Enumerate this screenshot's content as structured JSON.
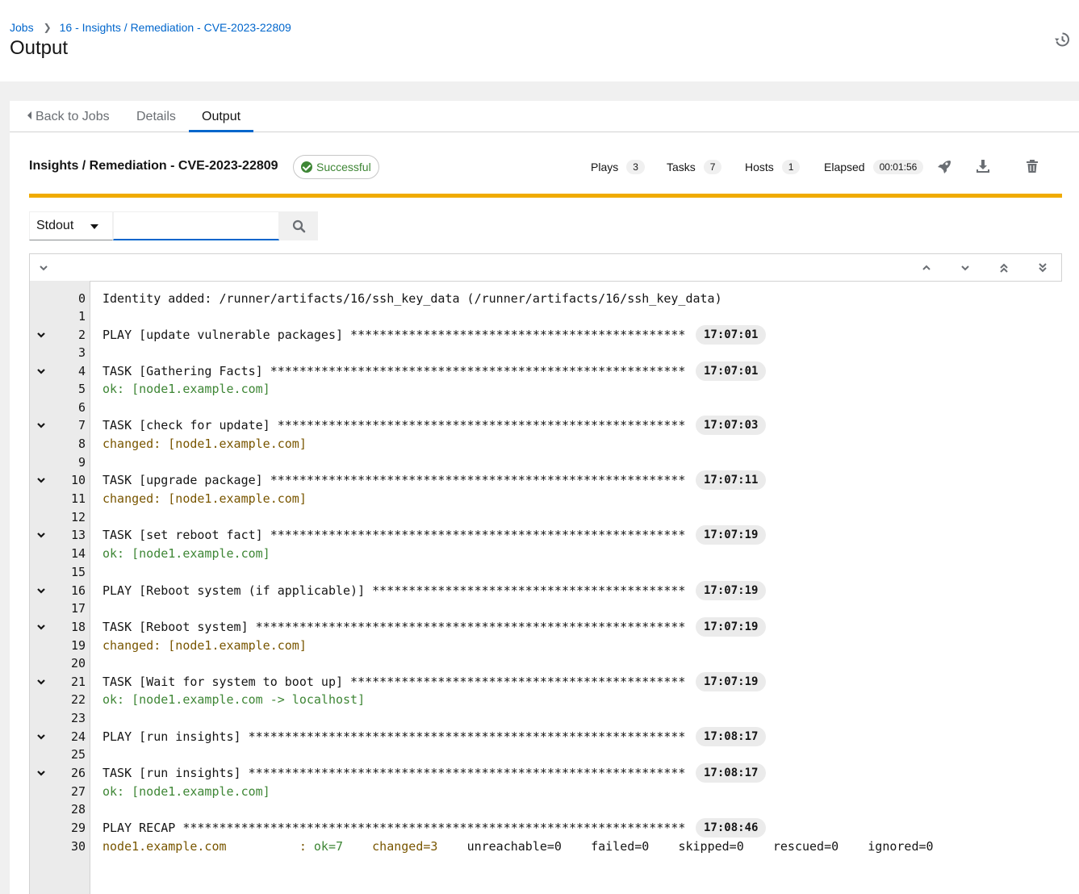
{
  "breadcrumb": {
    "root": "Jobs",
    "current": "16 - Insights / Remediation - CVE-2023-22809"
  },
  "page": {
    "title": "Output"
  },
  "tabs": {
    "back": "Back to Jobs",
    "details": "Details",
    "output": "Output"
  },
  "job": {
    "name": "Insights / Remediation - CVE-2023-22809",
    "status": "Successful"
  },
  "stats": {
    "plays_label": "Plays",
    "plays": "3",
    "tasks_label": "Tasks",
    "tasks": "7",
    "hosts_label": "Hosts",
    "hosts": "1",
    "elapsed_label": "Elapsed",
    "elapsed": "00:01:56"
  },
  "filter": {
    "select": "Stdout",
    "input_value": ""
  },
  "colors": {
    "accent": "#0066cc",
    "progress": "#f0ab00",
    "ok": "#3e8635",
    "changed": "#795600"
  },
  "icons": {
    "history": "history-icon",
    "relaunch": "rocket-icon",
    "download": "download-icon",
    "delete": "trash-icon",
    "search": "search-icon",
    "collapse_all": "chevron-down-icon",
    "scroll_up": "chevron-up-icon",
    "scroll_down": "chevron-down-icon",
    "scroll_top": "double-chevron-up-icon",
    "scroll_bottom": "double-chevron-down-icon"
  },
  "lines": [
    {
      "n": "0",
      "text": "Identity added: /runner/artifacts/16/ssh_key_data (/runner/artifacts/16/ssh_key_data)",
      "ts": "",
      "kind": "plain",
      "toggle": false
    },
    {
      "n": "1",
      "text": "",
      "ts": "",
      "kind": "plain",
      "toggle": false
    },
    {
      "n": "2",
      "text": "PLAY [update vulnerable packages] **********************************************",
      "ts": "17:07:01",
      "kind": "plain",
      "toggle": true
    },
    {
      "n": "3",
      "text": "",
      "ts": "",
      "kind": "plain",
      "toggle": false
    },
    {
      "n": "4",
      "text": "TASK [Gathering Facts] *********************************************************",
      "ts": "17:07:01",
      "kind": "plain",
      "toggle": true
    },
    {
      "n": "5",
      "text": "ok: [node1.example.com]",
      "ts": "",
      "kind": "ok",
      "toggle": false
    },
    {
      "n": "6",
      "text": "",
      "ts": "",
      "kind": "plain",
      "toggle": false
    },
    {
      "n": "7",
      "text": "TASK [check for update] ********************************************************",
      "ts": "17:07:03",
      "kind": "plain",
      "toggle": true
    },
    {
      "n": "8",
      "text": "changed: [node1.example.com]",
      "ts": "",
      "kind": "changed",
      "toggle": false
    },
    {
      "n": "9",
      "text": "",
      "ts": "",
      "kind": "plain",
      "toggle": false
    },
    {
      "n": "10",
      "text": "TASK [upgrade package] *********************************************************",
      "ts": "17:07:11",
      "kind": "plain",
      "toggle": true
    },
    {
      "n": "11",
      "text": "changed: [node1.example.com]",
      "ts": "",
      "kind": "changed",
      "toggle": false
    },
    {
      "n": "12",
      "text": "",
      "ts": "",
      "kind": "plain",
      "toggle": false
    },
    {
      "n": "13",
      "text": "TASK [set reboot fact] *********************************************************",
      "ts": "17:07:19",
      "kind": "plain",
      "toggle": true
    },
    {
      "n": "14",
      "text": "ok: [node1.example.com]",
      "ts": "",
      "kind": "ok",
      "toggle": false
    },
    {
      "n": "15",
      "text": "",
      "ts": "",
      "kind": "plain",
      "toggle": false
    },
    {
      "n": "16",
      "text": "PLAY [Reboot system (if applicable)] *******************************************",
      "ts": "17:07:19",
      "kind": "plain",
      "toggle": true
    },
    {
      "n": "17",
      "text": "",
      "ts": "",
      "kind": "plain",
      "toggle": false
    },
    {
      "n": "18",
      "text": "TASK [Reboot system] ***********************************************************",
      "ts": "17:07:19",
      "kind": "plain",
      "toggle": true
    },
    {
      "n": "19",
      "text": "changed: [node1.example.com]",
      "ts": "",
      "kind": "changed",
      "toggle": false
    },
    {
      "n": "20",
      "text": "",
      "ts": "",
      "kind": "plain",
      "toggle": false
    },
    {
      "n": "21",
      "text": "TASK [Wait for system to boot up] **********************************************",
      "ts": "17:07:19",
      "kind": "plain",
      "toggle": true
    },
    {
      "n": "22",
      "text": "ok: [node1.example.com -> localhost]",
      "ts": "",
      "kind": "ok",
      "toggle": false
    },
    {
      "n": "23",
      "text": "",
      "ts": "",
      "kind": "plain",
      "toggle": false
    },
    {
      "n": "24",
      "text": "PLAY [run insights] ************************************************************",
      "ts": "17:08:17",
      "kind": "plain",
      "toggle": true
    },
    {
      "n": "25",
      "text": "",
      "ts": "",
      "kind": "plain",
      "toggle": false
    },
    {
      "n": "26",
      "text": "TASK [run insights] ************************************************************",
      "ts": "17:08:17",
      "kind": "plain",
      "toggle": true
    },
    {
      "n": "27",
      "text": "ok: [node1.example.com]",
      "ts": "",
      "kind": "ok",
      "toggle": false
    },
    {
      "n": "28",
      "text": "",
      "ts": "",
      "kind": "plain",
      "toggle": false
    },
    {
      "n": "29",
      "text": "PLAY RECAP *********************************************************************",
      "ts": "17:08:46",
      "kind": "plain",
      "toggle": false
    },
    {
      "n": "30",
      "text": "",
      "ts": "",
      "kind": "recap",
      "toggle": false
    }
  ],
  "recap": {
    "host": "node1.example.com          : ",
    "ok": "ok=7",
    "changed": "changed=3",
    "rest": "unreachable=0    failed=0    skipped=0    rescued=0    ignored=0"
  }
}
